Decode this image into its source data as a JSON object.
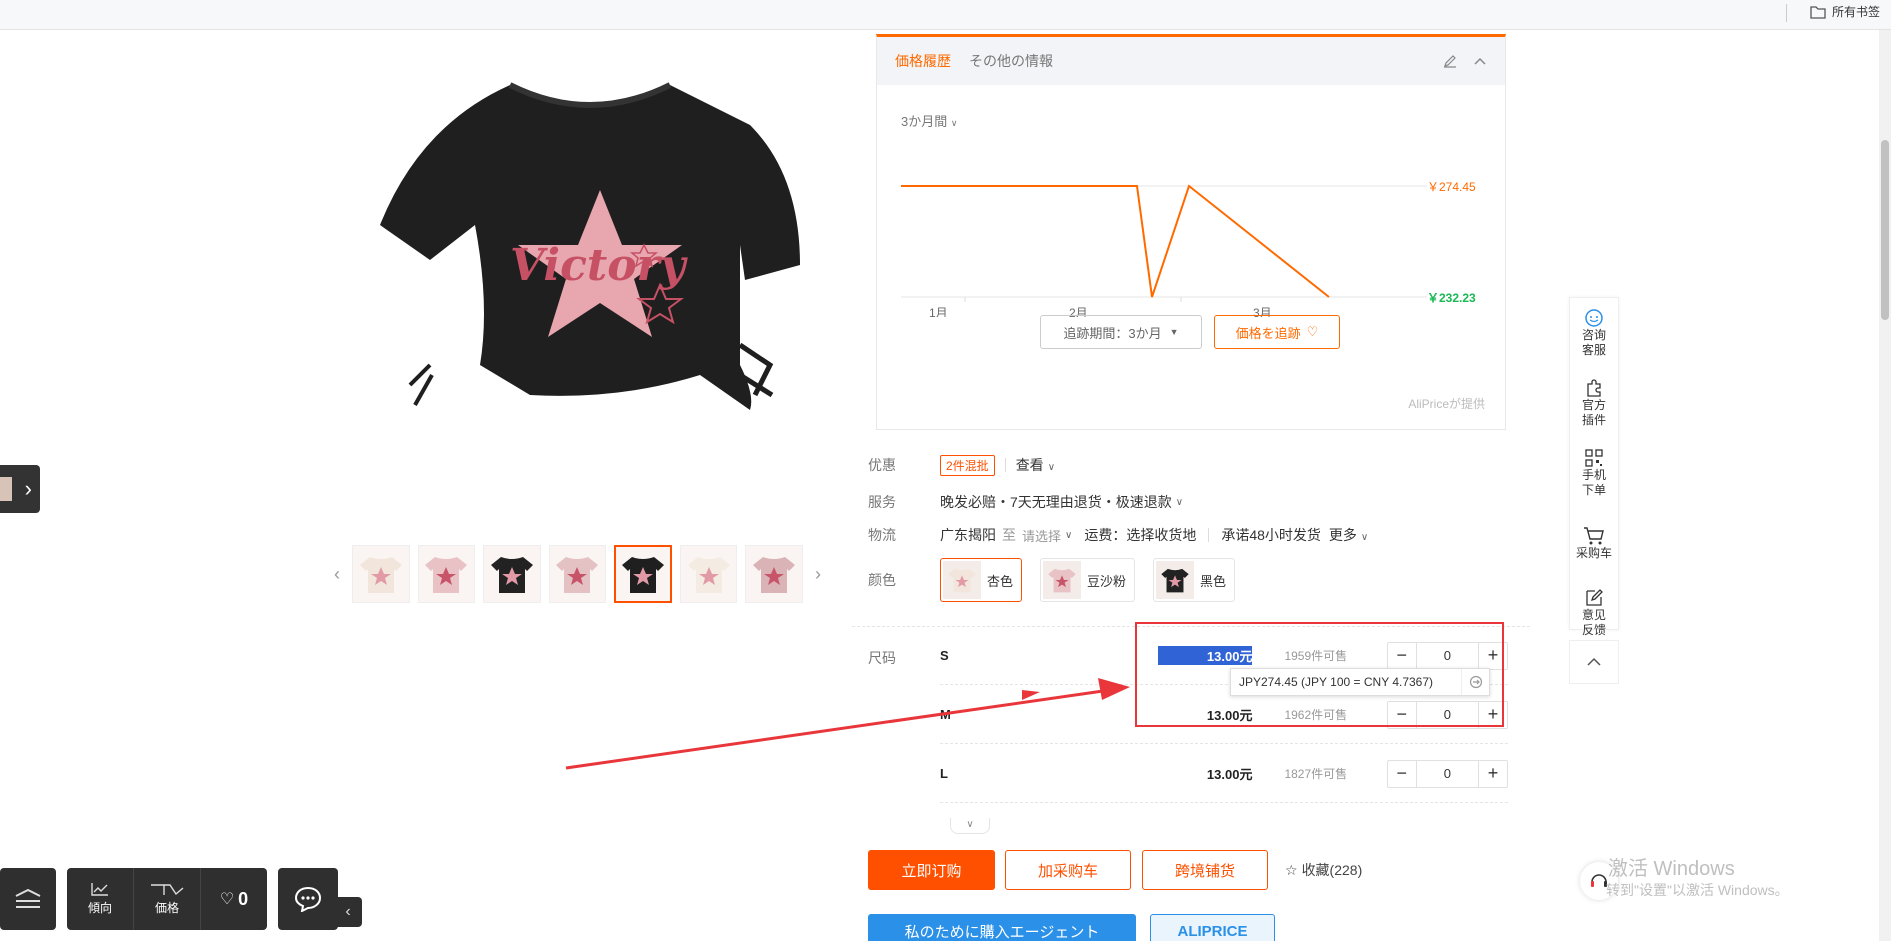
{
  "bookmarks": {
    "all_label": "所有书签"
  },
  "product_images": {
    "thumbs": [
      "apricot-front",
      "pink-front",
      "black-side",
      "pink-flat",
      "black-front",
      "apricot-flat",
      "pink-model"
    ],
    "active_index": 4
  },
  "price_history": {
    "tab_history": "価格履歴",
    "tab_other": "その他の情報",
    "range_label": "3か月間",
    "max_label": "￥274.45",
    "min_label": "￥232.23",
    "period_button": "追跡期間：3か月",
    "track_button": "価格を追跡",
    "provider": "AliPriceが提供",
    "colors": {
      "accent": "#ff6a00",
      "low": "#19b955"
    }
  },
  "chart_data": {
    "type": "line",
    "x_ticks": [
      "1月",
      "2月",
      "3月"
    ],
    "series": [
      {
        "values": [
          {
            "x": "1月初",
            "y": 274.45
          },
          {
            "x": "2月下旬",
            "y": 274.45
          },
          {
            "x": "2月末",
            "y": 232.23
          },
          {
            "x": "3月初",
            "y": 274.45
          },
          {
            "x": "3月末",
            "y": 232.23
          }
        ]
      }
    ],
    "ylim": [
      232.23,
      274.45
    ],
    "grid": false
  },
  "specs": {
    "promo": {
      "label": "优惠",
      "badge": "2件混批",
      "view": "查看"
    },
    "service": {
      "label": "服务",
      "value": "晚发必赔・7天无理由退货・极速退款"
    },
    "logistics": {
      "label": "物流",
      "origin": "广东揭阳",
      "to": "至",
      "select": "请选择",
      "fee": "运费：选择收货地",
      "promise": "承诺48小时发货",
      "more": "更多"
    },
    "color": {
      "label": "颜色",
      "options": [
        {
          "name": "杏色",
          "active": true
        },
        {
          "name": "豆沙粉",
          "active": false
        },
        {
          "name": "黑色",
          "active": false
        }
      ]
    },
    "size": {
      "label": "尺码",
      "rows": [
        {
          "name": "S",
          "price": "13.00元",
          "stock": "1959件可售",
          "qty": "0"
        },
        {
          "name": "M",
          "price": "13.00元",
          "stock": "1962件可售",
          "qty": "0"
        },
        {
          "name": "L",
          "price": "13.00元",
          "stock": "1827件可售",
          "qty": "0"
        }
      ]
    }
  },
  "tooltip": {
    "text": "JPY274.45 (JPY 100 = CNY 4.7367)"
  },
  "actions": {
    "order": "立即订购",
    "cart": "加采购车",
    "cross": "跨境铺货",
    "favorite": "收藏(228)",
    "agent": "私のために購入エージェント",
    "aliprice": "ALIPRICE"
  },
  "bottom_toolbar": {
    "trend": "傾向",
    "price": "価格",
    "likes": "0"
  },
  "right_panel": {
    "items": [
      "咨询\n客服",
      "官方\n插件",
      "手机\n下单",
      "采购车",
      "意见\n反馈"
    ]
  },
  "watermark": {
    "line1": "激活 Windows",
    "line2": "转到\"设置\"以激活 Windows。"
  },
  "annotation_color": "#e8363b"
}
